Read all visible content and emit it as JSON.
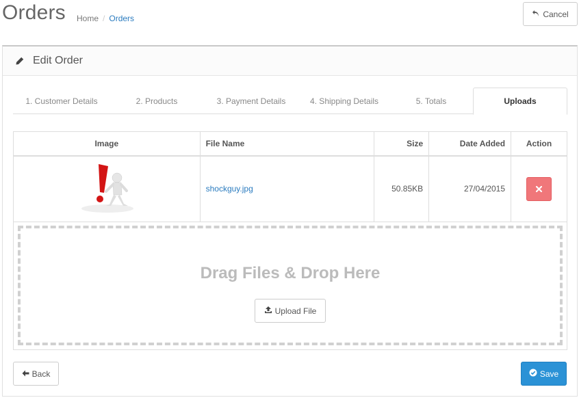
{
  "header": {
    "title": "Orders",
    "breadcrumb": {
      "home": "Home",
      "separator": "/",
      "current": "Orders"
    },
    "cancel_label": "Cancel"
  },
  "panel": {
    "title": "Edit Order"
  },
  "tabs": [
    {
      "label": "1. Customer Details",
      "active": false
    },
    {
      "label": "2. Products",
      "active": false
    },
    {
      "label": "3. Payment Details",
      "active": false
    },
    {
      "label": "4. Shipping Details",
      "active": false
    },
    {
      "label": "5. Totals",
      "active": false
    },
    {
      "label": "Uploads",
      "active": true
    }
  ],
  "table": {
    "columns": [
      "Image",
      "File Name",
      "Size",
      "Date Added",
      "Action"
    ],
    "rows": [
      {
        "file_name": "shockguy.jpg",
        "size": "50.85KB",
        "date_added": "27/04/2015",
        "delete_icon": "times-icon"
      }
    ]
  },
  "dropzone": {
    "title": "Drag Files & Drop Here",
    "upload_label": "Upload File"
  },
  "footer": {
    "back_label": "Back",
    "save_label": "Save"
  },
  "colors": {
    "link": "#2a7bbf",
    "danger": "#f0777a",
    "primary": "#2b92d6"
  }
}
